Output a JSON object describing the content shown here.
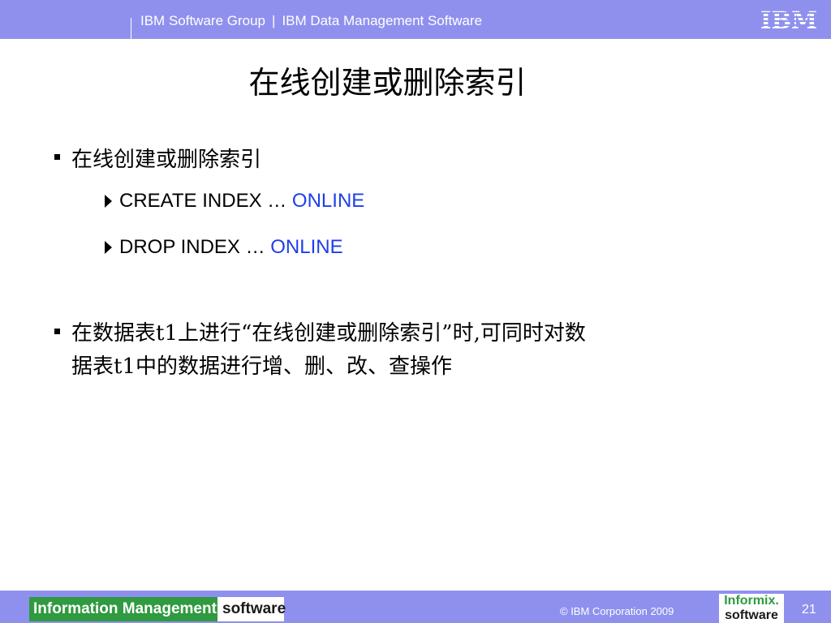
{
  "header": {
    "group": "IBM Software Group",
    "separator": "|",
    "division": "IBM Data Management Software",
    "logo_text": "IBM"
  },
  "slide": {
    "title": "在线创建或删除索引",
    "bullets": [
      {
        "text": "在线创建或删除索引",
        "sub_items": [
          {
            "prefix": "CREATE INDEX … ",
            "accent": "ONLINE"
          },
          {
            "prefix": "DROP INDEX … ",
            "accent": "ONLINE"
          }
        ]
      },
      {
        "line1": "在数据表t1上进行“在线创建或删除索引”时,可同时对数",
        "line2": "据表t1中的数据进行增、删、改、查操作"
      }
    ]
  },
  "footer": {
    "im_logo_main": "Information Management",
    "im_logo_sub": "software",
    "copyright": "© IBM Corporation 2009",
    "informix_top": "Informix.",
    "informix_bottom": "software",
    "page_number": "21"
  },
  "colors": {
    "bar": "#8f90ee",
    "accent": "#1f3fe8",
    "im_green": "#2f9a3f"
  },
  "icons": [
    "square-bullet-icon",
    "triangle-arrow-icon",
    "ibm-logo-icon"
  ]
}
